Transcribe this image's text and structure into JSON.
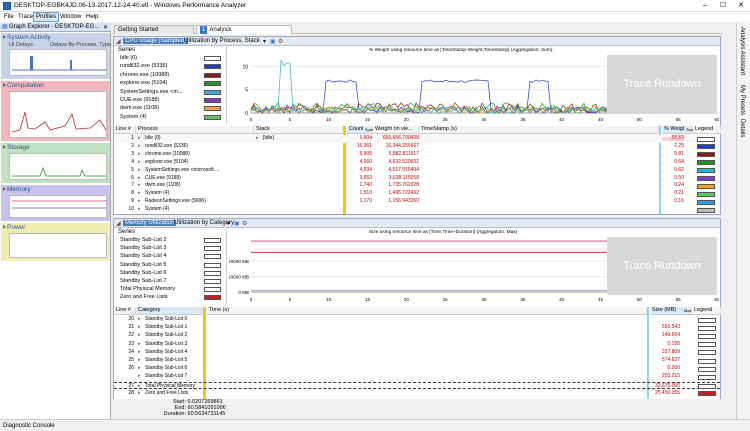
{
  "title": "DESKTOP-EGBK4JD.06-13-2017.12-24-40.etl - Windows Performance Analyzer",
  "window_controls": {
    "min": "–",
    "max": "☐",
    "close": "✕"
  },
  "menu": [
    "File",
    "Trace",
    "Profiles",
    "Window",
    "Help"
  ],
  "graph_explorer": {
    "title": "Graph Explorer - DESKTOP-EG...",
    "sections": [
      {
        "name": "System Activity",
        "sub1": "UI Delays",
        "sub2": "Delays By Process, Type",
        "color": "#c9d4ea"
      },
      {
        "name": "Computation",
        "color": "#f2b6bd"
      },
      {
        "name": "Storage",
        "color": "#bfe3c0"
      },
      {
        "name": "Memory",
        "color": "#c8c3ea"
      },
      {
        "name": "Power",
        "color": "#f0edb0"
      }
    ]
  },
  "tabs": [
    {
      "label": "Getting Started"
    },
    {
      "num": "1",
      "label": "Analysis"
    }
  ],
  "right_strip": [
    "Analysis Assistant",
    "My Presets",
    "Details"
  ],
  "cpu_panel": {
    "title": "CPU Usage (Sampled)",
    "preset": "Utilization by Process, Stack",
    "series_header": "Series",
    "chart_title": "% Weight using resource time as [TimeStamp-Weight,TimeStamp] (Aggregation: Sum)",
    "y_ticks": [
      "10",
      "5",
      "0"
    ],
    "x_ticks": [
      "0",
      "5",
      "10",
      "15",
      "20",
      "25",
      "30",
      "35",
      "40",
      "45",
      "50",
      "55",
      "60"
    ],
    "trace_rundown": "Trace Rundown",
    "series": [
      {
        "name": "Idle (0)",
        "color": "#ffffff"
      },
      {
        "name": "rundll32.exe (5336)",
        "color": "#1f3fbf"
      },
      {
        "name": "chrome.exe (10088)",
        "color": "#8b1a1a"
      },
      {
        "name": "explorer.exe (5104)",
        "color": "#2a8f2a"
      },
      {
        "name": "SystemSettings.exe <m...",
        "color": "#29b5d8"
      },
      {
        "name": "CUE.exe (9188)",
        "color": "#7a3fbf"
      },
      {
        "name": "dwm.exe (1108)",
        "color": "#f5a623"
      },
      {
        "name": "System (4)",
        "color": "#5fc35f"
      }
    ],
    "table": {
      "headers": [
        "Line #",
        "Process",
        "Stack",
        "Count",
        "Sum",
        "Weight (in vie...",
        "TimeStamp (s)",
        "% Weight",
        "Sum",
        "Legend"
      ],
      "rows": [
        {
          "line": "1",
          "process": "Idle (0)",
          "stack": "[Idle]",
          "count": "1,604",
          "weight": "665,656.700438",
          "pct": "58.83",
          "color": "#ffffff"
        },
        {
          "line": "2",
          "process": "rundll32.exe (5336)",
          "stack": "",
          "count": "16,361",
          "weight": "16,344.355667",
          "pct": "2.25",
          "color": "#1f3fbf"
        },
        {
          "line": "3",
          "process": "chrome.exe (10088)",
          "stack": "",
          "count": "5,905",
          "weight": "5,882.811517",
          "pct": "0.81",
          "color": "#8b1a1a"
        },
        {
          "line": "4",
          "process": "explorer.exe (5104)",
          "stack": "",
          "count": "4,660",
          "weight": "4,632.520652",
          "pct": "0.64",
          "color": "#2a8f2a"
        },
        {
          "line": "5",
          "process": "SystemSettings.exe <microsoft....",
          "stack": "",
          "count": "4,534",
          "weight": "4,517.915404",
          "pct": "0.62",
          "color": "#29b5d8"
        },
        {
          "line": "6",
          "process": "CUE.exe (9188)",
          "stack": "",
          "count": "3,653",
          "weight": "3,638.115058",
          "pct": "0.50",
          "color": "#7a3fbf"
        },
        {
          "line": "7",
          "process": "dwm.exe (1108)",
          "stack": "",
          "count": "1,740",
          "weight": "1,735.762328",
          "pct": "0.24",
          "color": "#f5a623"
        },
        {
          "line": "8",
          "process": "System (4)",
          "stack": "",
          "count": "1,510",
          "weight": "1,495.722492",
          "pct": "0.21",
          "color": "#5fc35f"
        },
        {
          "line": "9",
          "process": "RadeonSettings.exe (5696)",
          "stack": "",
          "count": "1,170",
          "weight": "1,156.943260",
          "pct": "0.16",
          "color": "#2a9fd8"
        },
        {
          "line": "10",
          "process": "System (4)",
          "stack": "",
          "count": "",
          "weight": "",
          "pct": "",
          "color": "#bbbbbb"
        }
      ]
    }
  },
  "mem_panel": {
    "title": "Memory Utilization",
    "preset": "Utilization by Category",
    "series_header": "Series",
    "chart_title": "Size using resource time as [Time,Time+Duration] (Aggregation: Max)",
    "y_ticks": [
      "20000 MB",
      "10000 MB",
      "0 MB"
    ],
    "x_ticks": [
      "0",
      "5",
      "10",
      "15",
      "20",
      "25",
      "30",
      "35",
      "40",
      "45",
      "50",
      "55",
      "60"
    ],
    "trace_rundown": "Trace Rundown",
    "series": [
      {
        "name": "Standby Sub-List 2",
        "color": "#ffffff"
      },
      {
        "name": "Standby Sub-List 3",
        "color": "#ffffff"
      },
      {
        "name": "Standby Sub-List 4",
        "color": "#ffffff"
      },
      {
        "name": "Standby Sub-List 5",
        "color": "#ffffff"
      },
      {
        "name": "Standby Sub-List 6",
        "color": "#ffffff"
      },
      {
        "name": "Standby Sub-List 7",
        "color": "#ffffff"
      },
      {
        "name": "Total Physical Memory",
        "color": "#ffffff"
      },
      {
        "name": "Zero and Free Lists",
        "color": "#c02020"
      }
    ],
    "table": {
      "headers": [
        "Line #",
        "Category",
        "Time (s)",
        "Size (MB)",
        "Max",
        "Legend"
      ],
      "rows": [
        {
          "line": "20",
          "category": "Standby Sub-List 0",
          "size": "",
          "color": "#ffffff"
        },
        {
          "line": "21",
          "category": "Standby Sub-List 1",
          "size": "550.543",
          "color": "#ffffff"
        },
        {
          "line": "22",
          "category": "Standby Sub-List 2",
          "size": "149.664",
          "color": "#ffffff"
        },
        {
          "line": "23",
          "category": "Standby Sub-List 3",
          "size": "0.195",
          "color": "#ffffff"
        },
        {
          "line": "24",
          "category": "Standby Sub-List 4",
          "size": "337.809",
          "color": "#ffffff"
        },
        {
          "line": "25",
          "category": "Standby Sub-List 5",
          "size": "574.637",
          "color": "#ffffff"
        },
        {
          "line": "26",
          "category": "Standby Sub-List 6",
          "size": "0.000",
          "color": "#ffffff"
        },
        {
          "line": "",
          "category": "Standby Sub-List 7",
          "size": "203.215",
          "color": "#ffffff"
        },
        {
          "line": "27",
          "category": "Total Physical Memory",
          "size": "32,676.000",
          "color": "#ffffff"
        },
        {
          "line": "28",
          "category": "Zero and Free Lists",
          "size": "25,450.055",
          "color": "#c02020"
        }
      ]
    }
  },
  "selection": {
    "start_label": "Start:",
    "start": "0.0207269861",
    "end_label": "End:",
    "end": "60.5841091006",
    "duration_label": "Duration:",
    "duration": "60.5634731145"
  },
  "status": "Diagnostic Console",
  "colors": {
    "accent": "#3a78c8",
    "yellow_sel": "#f5c518",
    "cyan_sel": "#8fd3f0"
  }
}
